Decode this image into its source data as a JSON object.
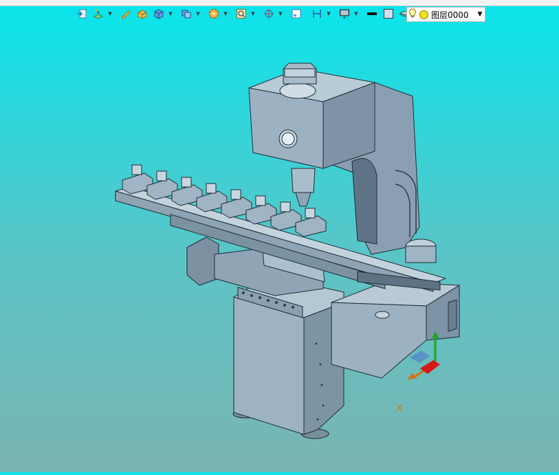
{
  "toolbar": {
    "tools": [
      {
        "icon": "exit-sketch-icon",
        "dropdown": false
      },
      {
        "icon": "sketch-plane-icon",
        "dropdown": true
      },
      {
        "icon": "pencil-icon",
        "dropdown": false
      },
      {
        "icon": "extrude-icon",
        "dropdown": false
      },
      {
        "icon": "cube-icon",
        "dropdown": true
      },
      {
        "icon": "boolean-icon",
        "dropdown": true
      },
      {
        "icon": "render-mode-icon",
        "dropdown": true
      },
      {
        "icon": "zoom-fit-icon",
        "dropdown": true
      },
      {
        "icon": "orbit-icon",
        "dropdown": true
      },
      {
        "icon": "view-box-icon",
        "dropdown": false
      },
      {
        "icon": "section-icon",
        "dropdown": true
      },
      {
        "icon": "monitor-icon",
        "dropdown": true
      },
      {
        "icon": "line-color-icon",
        "dropdown": false
      },
      {
        "icon": "fill-color-icon",
        "dropdown": false
      },
      {
        "icon": "layer-manager-icon",
        "dropdown": true
      }
    ],
    "layer": {
      "current": "图层0000",
      "bulb_icon": "lightbulb-icon",
      "color": "#f6e21a"
    }
  },
  "viewport": {
    "background_top": "#08e6ec",
    "background_bottom": "#7ab4b2",
    "model_color": "#93a9ba",
    "axis_label": "X"
  }
}
